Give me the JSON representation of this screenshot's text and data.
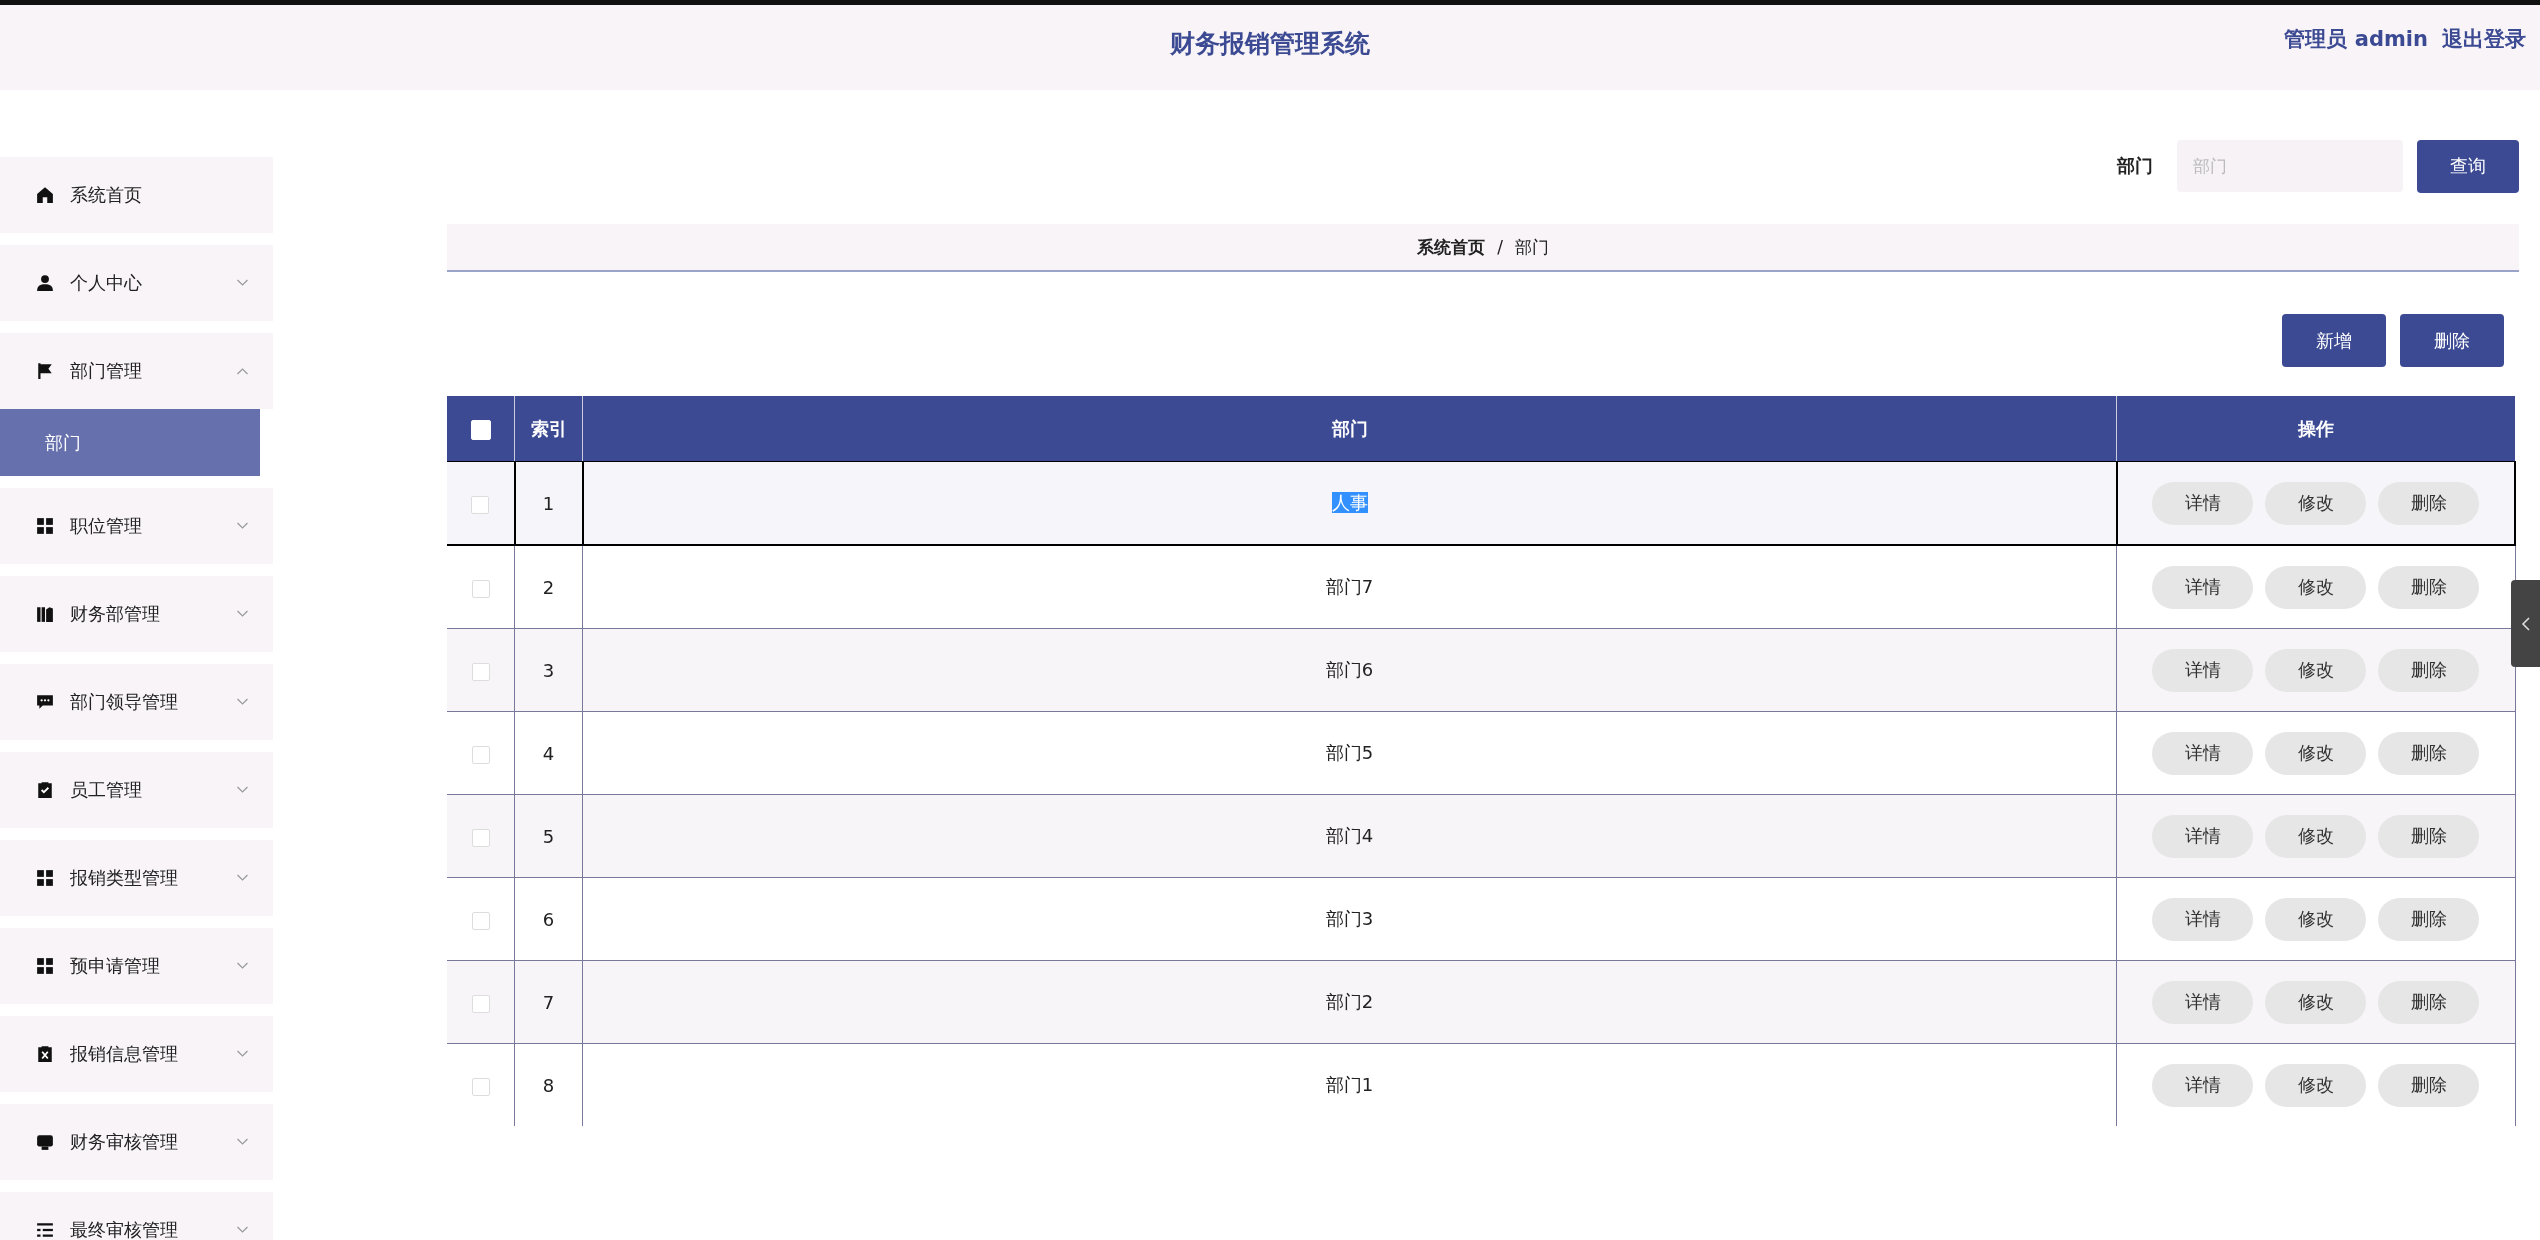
{
  "header": {
    "title": "财务报销管理系统",
    "user": "管理员 admin",
    "logout": "退出登录"
  },
  "sidebar": {
    "items": [
      {
        "label": "系统首页",
        "kind": "link"
      },
      {
        "label": "个人中心",
        "kind": "menu",
        "expanded": false
      },
      {
        "label": "部门管理",
        "kind": "menu",
        "expanded": true,
        "children": [
          {
            "label": "部门",
            "selected": true
          }
        ]
      },
      {
        "label": "职位管理",
        "kind": "menu",
        "expanded": false
      },
      {
        "label": "财务部管理",
        "kind": "menu",
        "expanded": false
      },
      {
        "label": "部门领导管理",
        "kind": "menu",
        "expanded": false
      },
      {
        "label": "员工管理",
        "kind": "menu",
        "expanded": false
      },
      {
        "label": "报销类型管理",
        "kind": "menu",
        "expanded": false
      },
      {
        "label": "预申请管理",
        "kind": "menu",
        "expanded": false
      },
      {
        "label": "报销信息管理",
        "kind": "menu",
        "expanded": false
      },
      {
        "label": "财务审核管理",
        "kind": "menu",
        "expanded": false
      },
      {
        "label": "最终审核管理",
        "kind": "menu",
        "expanded": false
      }
    ]
  },
  "search": {
    "label": "部门",
    "placeholder": "部门",
    "button": "查询"
  },
  "breadcrumb": [
    "系统首页",
    "/",
    "部门"
  ],
  "actions": [
    "新增",
    "删除"
  ],
  "table": {
    "columns": [
      "索引",
      "部门",
      "操作"
    ],
    "all_checked": false,
    "rows": [
      {
        "index": "1",
        "name": "人事",
        "checked": false,
        "hovered": true,
        "text_selected": true,
        "ops": [
          "详情",
          "修改",
          "删除"
        ]
      },
      {
        "index": "2",
        "name": "部门7",
        "checked": false,
        "hovered": false,
        "text_selected": false,
        "ops": [
          "详情",
          "修改",
          "删除"
        ]
      },
      {
        "index": "3",
        "name": "部门6",
        "checked": false,
        "hovered": false,
        "text_selected": false,
        "ops": [
          "详情",
          "修改",
          "删除"
        ]
      },
      {
        "index": "4",
        "name": "部门5",
        "checked": false,
        "hovered": false,
        "text_selected": false,
        "ops": [
          "详情",
          "修改",
          "删除"
        ]
      },
      {
        "index": "5",
        "name": "部门4",
        "checked": false,
        "hovered": false,
        "text_selected": false,
        "ops": [
          "详情",
          "修改",
          "删除"
        ]
      },
      {
        "index": "6",
        "name": "部门3",
        "checked": false,
        "hovered": false,
        "text_selected": false,
        "ops": [
          "详情",
          "修改",
          "删除"
        ]
      },
      {
        "index": "7",
        "name": "部门2",
        "checked": false,
        "hovered": false,
        "text_selected": false,
        "ops": [
          "详情",
          "修改",
          "删除"
        ]
      },
      {
        "index": "8",
        "name": "部门1",
        "checked": false,
        "hovered": false,
        "text_selected": false,
        "ops": [
          "详情",
          "修改",
          "删除"
        ]
      }
    ]
  }
}
